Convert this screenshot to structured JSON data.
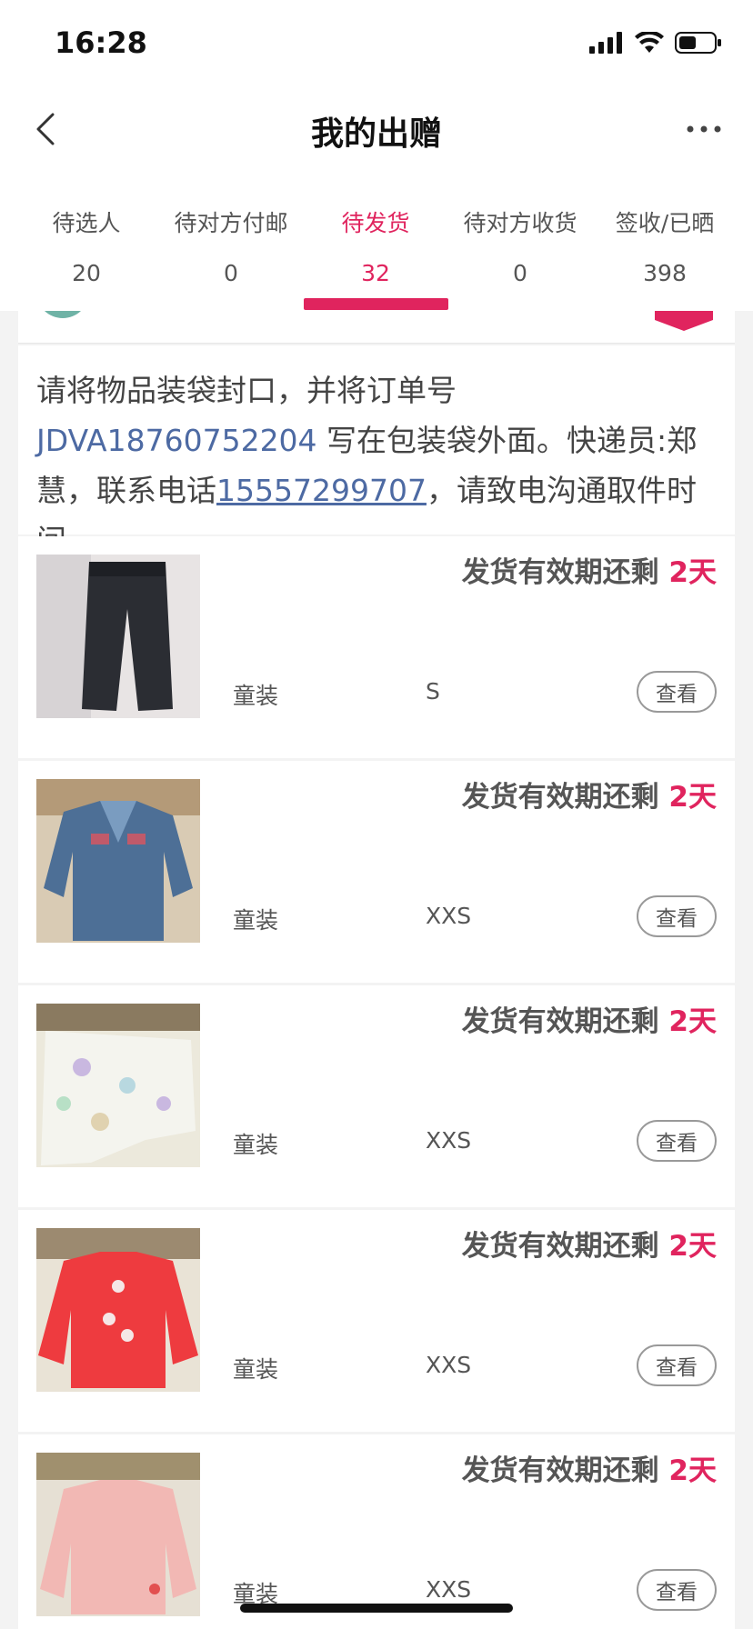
{
  "status_bar": {
    "time": "16:28"
  },
  "nav": {
    "title": "我的出赠",
    "back_icon": "chevron-left-icon",
    "more_icon": "more-horizontal-icon"
  },
  "tabs": [
    {
      "label": "待选人",
      "count": "20"
    },
    {
      "label": "待对方付邮",
      "count": "0"
    },
    {
      "label": "待发货",
      "count": "32",
      "active": true
    },
    {
      "label": "待对方收货",
      "count": "0"
    },
    {
      "label": "签收/已晒",
      "count": "398"
    }
  ],
  "notice": {
    "text_before": "请将物品装袋封口，并将订单号 ",
    "order_no": "JDVA18760752204",
    "text_middle": " 写在包装袋外面。快递员:郑慧，联系电话",
    "phone": "15557299707",
    "text_after": "，请致电沟通取件时间。"
  },
  "items": [
    {
      "deadline_label": "发货有效期还剩",
      "deadline_days": "2天",
      "category": "童装",
      "size": "S",
      "button": "查看",
      "image": "dark-jeans"
    },
    {
      "deadline_label": "发货有效期还剩",
      "deadline_days": "2天",
      "category": "童装",
      "size": "XXS",
      "button": "查看",
      "image": "denim-jacket"
    },
    {
      "deadline_label": "发货有效期还剩",
      "deadline_days": "2天",
      "category": "童装",
      "size": "XXS",
      "button": "查看",
      "image": "printed-leggings"
    },
    {
      "deadline_label": "发货有效期还剩",
      "deadline_days": "2天",
      "category": "童装",
      "size": "XXS",
      "button": "查看",
      "image": "red-sweater"
    },
    {
      "deadline_label": "发货有效期还剩",
      "deadline_days": "2天",
      "category": "童装",
      "size": "XXS",
      "button": "查看",
      "image": "pink-top"
    }
  ],
  "colors": {
    "accent": "#e0245e",
    "link": "#4d6aa3"
  }
}
